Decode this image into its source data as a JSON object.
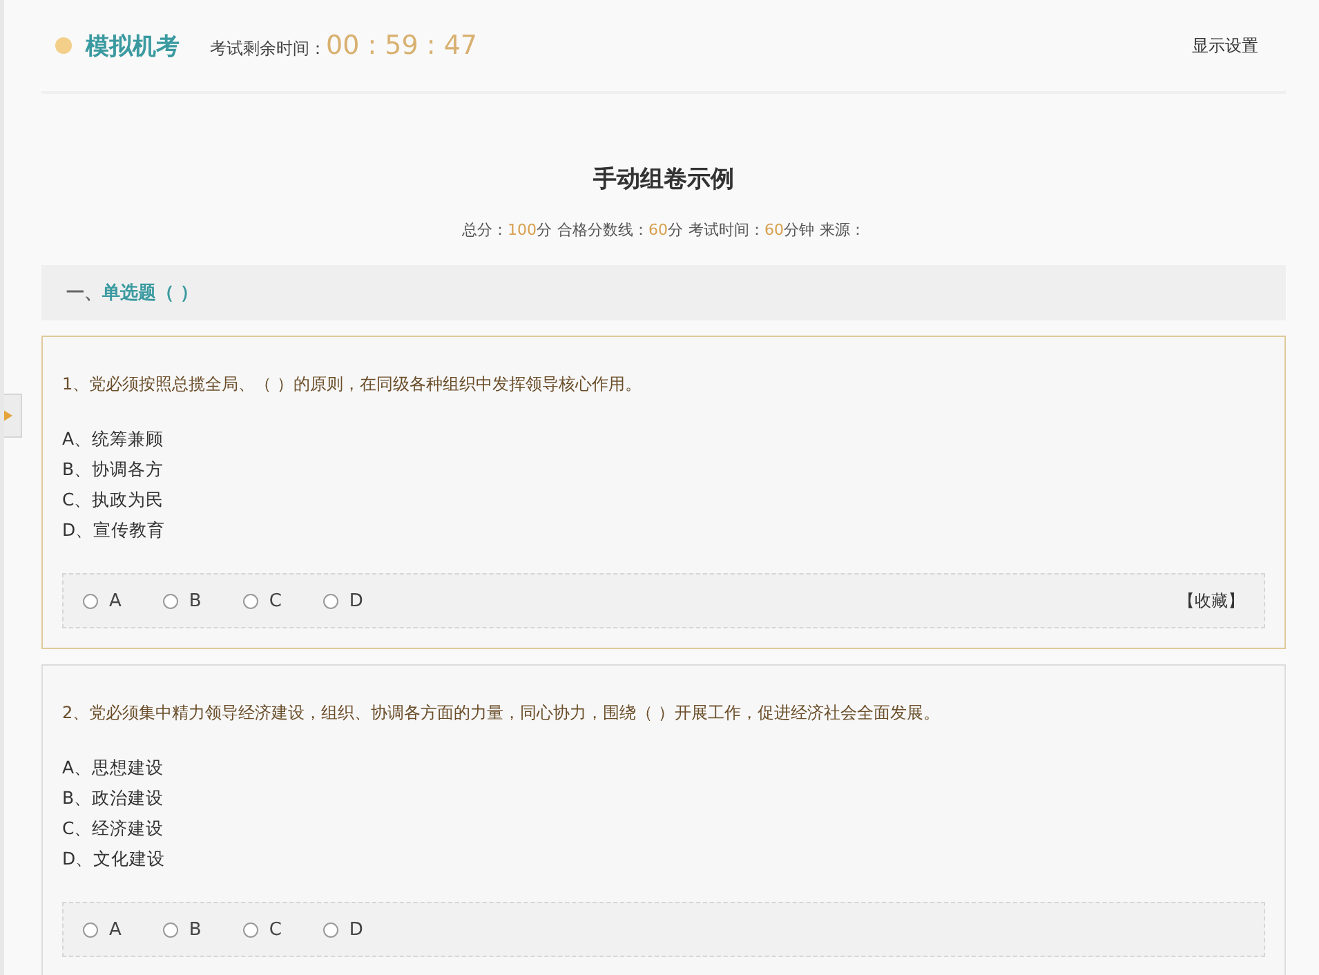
{
  "header": {
    "title": "模拟机考",
    "timer_label": "考试剩余时间：",
    "timer": "00 : 59 : 47",
    "settings": "显示设置"
  },
  "paper": {
    "title": "手动组卷示例",
    "summary": [
      {
        "label": "总分：",
        "value": "100",
        "unit": "分"
      },
      {
        "label": "合格分数线：",
        "value": "60",
        "unit": "分"
      },
      {
        "label": "考试时间：",
        "value": "60",
        "unit": "分钟"
      },
      {
        "label": "来源："
      }
    ]
  },
  "section": {
    "prefix": "一、",
    "title": "单选题（ ）"
  },
  "questions": [
    {
      "text": "1、党必须按照总揽全局、（ ）的原则，在同级各种组织中发挥领导核心作用。",
      "current": true,
      "options": [
        "A、统筹兼顾",
        "B、协调各方",
        "C、执政为民",
        "D、宣传教育"
      ],
      "answers": [
        {
          "label": "A",
          "selected": false
        },
        {
          "label": "B",
          "selected": false
        },
        {
          "label": "C",
          "selected": false
        },
        {
          "label": "D",
          "selected": false
        }
      ],
      "favorite": "【收藏】"
    },
    {
      "text": "2、党必须集中精力领导经济建设，组织、协调各方面的力量，同心协力，围绕（ ）开展工作，促进经济社会全面发展。",
      "current": false,
      "options": [
        "A、思想建设",
        "B、政治建设",
        "C、经济建设",
        "D、文化建设"
      ],
      "answers": [
        {
          "label": "A",
          "selected": false
        },
        {
          "label": "B",
          "selected": false
        },
        {
          "label": "C",
          "selected": false
        },
        {
          "label": "D",
          "selected": false
        }
      ]
    }
  ]
}
